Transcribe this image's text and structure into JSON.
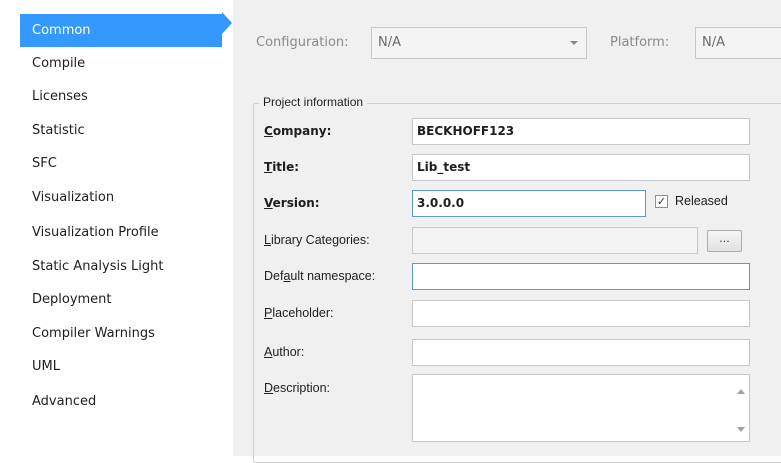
{
  "sidebar": {
    "items": [
      {
        "label": "Common"
      },
      {
        "label": "Compile"
      },
      {
        "label": "Licenses"
      },
      {
        "label": "Statistic"
      },
      {
        "label": "SFC"
      },
      {
        "label": "Visualization"
      },
      {
        "label": "Visualization Profile"
      },
      {
        "label": "Static Analysis Light"
      },
      {
        "label": "Deployment"
      },
      {
        "label": "Compiler Warnings"
      },
      {
        "label": "UML"
      },
      {
        "label": "Advanced"
      }
    ],
    "active_index": 0
  },
  "toolbar": {
    "configuration_label": "Configuration:",
    "configuration_value": "N/A",
    "platform_label": "Platform:",
    "platform_value": "N/A"
  },
  "group": {
    "title": "Project information",
    "company": {
      "label": "Company:",
      "value": "BECKHOFF123"
    },
    "title_field": {
      "label": "Title:",
      "value": "Lib_test"
    },
    "version": {
      "label": "Version:",
      "value": "3.0.0.0"
    },
    "released": {
      "label": "Released",
      "checked": true,
      "mark": "✓"
    },
    "library_categories": {
      "label": "Library Categories:",
      "value": "",
      "button_label": "..."
    },
    "default_namespace": {
      "label": "Default namespace:",
      "value": ""
    },
    "placeholder": {
      "label": "Placeholder:",
      "value": ""
    },
    "author": {
      "label": "Author:",
      "value": ""
    },
    "description": {
      "label": "Description:",
      "value": ""
    }
  },
  "colors": {
    "accent": "#3399ff",
    "panel_bg": "#f0f0f0",
    "focus_border": "#5b9bd5"
  }
}
